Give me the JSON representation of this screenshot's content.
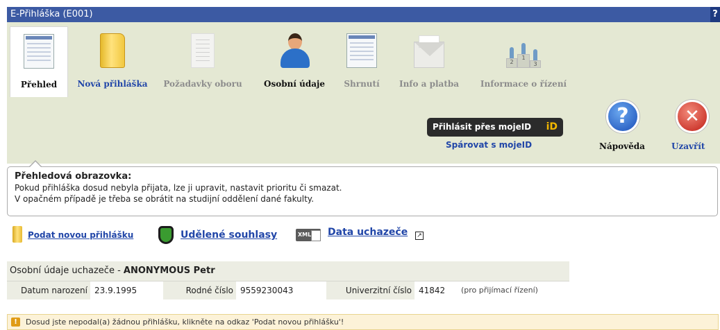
{
  "window": {
    "title": "E-Přihláška (E001)",
    "help_glyph": "?"
  },
  "tabs": [
    {
      "label": "Přehled",
      "icon": "overview-screen-icon",
      "state": "active"
    },
    {
      "label": "Nová přihláška",
      "icon": "folder-icon",
      "state": "link"
    },
    {
      "label": "Požadavky oboru",
      "icon": "document-icon",
      "state": "disabled"
    },
    {
      "label": "Osobní údaje",
      "icon": "person-icon",
      "state": "enabled"
    },
    {
      "label": "Shrnutí",
      "icon": "summary-screen-icon",
      "state": "disabled"
    },
    {
      "label": "Info a platba",
      "icon": "envelope-icon",
      "state": "disabled"
    },
    {
      "label": "Informace o řízení",
      "icon": "podium-icon",
      "state": "disabled"
    }
  ],
  "mojeid": {
    "button_label": "Přihlásit přes mojeID",
    "logo_text": "iD",
    "pair_link": "Spárovat s mojeID"
  },
  "actions": {
    "help_label": "Nápověda",
    "help_glyph": "?",
    "close_label": "Uzavřít",
    "close_glyph": "✕"
  },
  "info": {
    "heading": "Přehledová obrazovka:",
    "line1": "Pokud přihláška dosud nebyla přijata, lze ji upravit, nastavit prioritu či smazat.",
    "line2": "V opačném případě je třeba se obrátit na studijní oddělení dané fakulty."
  },
  "links": {
    "new_application": "Podat novou přihlášku",
    "consents": "Udělené souhlasy",
    "applicant_data": "Data uchazeče",
    "xml_badge": "XML"
  },
  "applicant": {
    "heading_prefix": "Osobní údaje uchazeče -",
    "name": "ANONYMOUS Petr",
    "birth_label": "Datum narození",
    "birth_value": "23.9.1995",
    "id_label": "Rodné číslo",
    "id_value": "9559230043",
    "uni_label": "Univerzitní číslo",
    "uni_value": "41842",
    "uni_note": "(pro přijímací řízení)"
  },
  "warning": {
    "icon": "!",
    "text": "Dosud jste nepodal(a) žádnou přihlášku, klikněte na odkaz 'Podat novou přihlášku'!"
  },
  "colors": {
    "titlebar": "#3c5aa3",
    "toolbar": "#e4e8d3",
    "link": "#2146a8",
    "warning_bg": "#fcf2d8"
  }
}
